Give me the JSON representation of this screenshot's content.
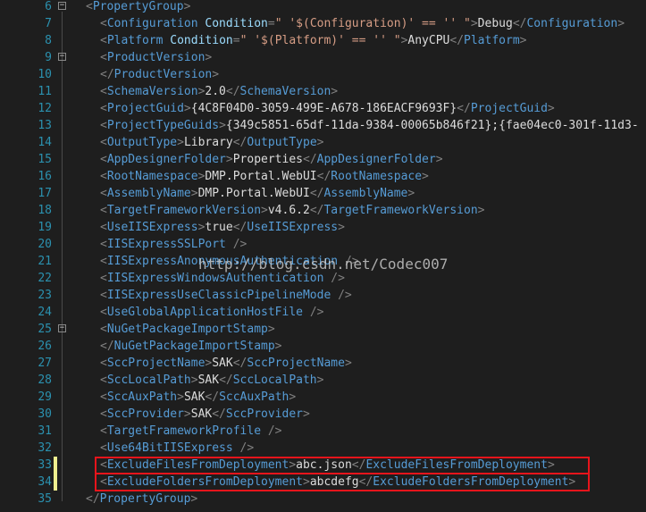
{
  "editor": {
    "lines": [
      {
        "number": "6",
        "fold": "−",
        "text": "<PropertyGroup>"
      },
      {
        "number": "7",
        "text": "<Configuration Condition=\" '$(Configuration)' == '' \">Debug</Configuration>"
      },
      {
        "number": "8",
        "text": "<Platform Condition=\" '$(Platform)' == '' \">AnyCPU</Platform>"
      },
      {
        "number": "9",
        "fold": "−",
        "text": "<ProductVersion>"
      },
      {
        "number": "10",
        "text": "</ProductVersion>"
      },
      {
        "number": "11",
        "text": "<SchemaVersion>2.0</SchemaVersion>"
      },
      {
        "number": "12",
        "text": "<ProjectGuid>{4C8F04D0-3059-499E-A678-186EACF9693F}</ProjectGuid>"
      },
      {
        "number": "13",
        "text": "<ProjectTypeGuids>{349c5851-65df-11da-9384-00065b846f21};{fae04ec0-301f-11d3-"
      },
      {
        "number": "14",
        "text": "<OutputType>Library</OutputType>"
      },
      {
        "number": "15",
        "text": "<AppDesignerFolder>Properties</AppDesignerFolder>"
      },
      {
        "number": "16",
        "text": "<RootNamespace>DMP.Portal.WebUI</RootNamespace>"
      },
      {
        "number": "17",
        "text": "<AssemblyName>DMP.Portal.WebUI</AssemblyName>"
      },
      {
        "number": "18",
        "text": "<TargetFrameworkVersion>v4.6.2</TargetFrameworkVersion>"
      },
      {
        "number": "19",
        "text": "<UseIISExpress>true</UseIISExpress>"
      },
      {
        "number": "20",
        "text": "<IISExpressSSLPort />"
      },
      {
        "number": "21",
        "text": "<IISExpressAnonymousAuthentication />"
      },
      {
        "number": "22",
        "text": "<IISExpressWindowsAuthentication />"
      },
      {
        "number": "23",
        "text": "<IISExpressUseClassicPipelineMode />"
      },
      {
        "number": "24",
        "text": "<UseGlobalApplicationHostFile />"
      },
      {
        "number": "25",
        "fold": "−",
        "text": "<NuGetPackageImportStamp>"
      },
      {
        "number": "26",
        "text": "</NuGetPackageImportStamp>"
      },
      {
        "number": "27",
        "text": "<SccProjectName>SAK</SccProjectName>"
      },
      {
        "number": "28",
        "text": "<SccLocalPath>SAK</SccLocalPath>"
      },
      {
        "number": "29",
        "text": "<SccAuxPath>SAK</SccAuxPath>"
      },
      {
        "number": "30",
        "text": "<SccProvider>SAK</SccProvider>"
      },
      {
        "number": "31",
        "text": "<TargetFrameworkProfile />"
      },
      {
        "number": "32",
        "text": "<Use64BitIISExpress />"
      },
      {
        "number": "33",
        "changed": true,
        "text": "<ExcludeFilesFromDeployment>abc.json</ExcludeFilesFromDeployment>"
      },
      {
        "number": "34",
        "changed": true,
        "text": "<ExcludeFoldersFromDeployment>abcdefg</ExcludeFoldersFromDeployment>"
      },
      {
        "number": "35",
        "text": "</PropertyGroup>"
      }
    ],
    "watermark": "http://blog.csdn.net/Codec007"
  },
  "colors": {
    "background": "#1e1e1e",
    "line_number": "#2b91af",
    "punctuation": "#808080",
    "tag": "#569cd6",
    "attribute": "#9cdcfe",
    "string": "#d69d85",
    "text": "#dcdcdc",
    "change_marker": "#efef8f",
    "highlight_box": "#e8141b"
  }
}
